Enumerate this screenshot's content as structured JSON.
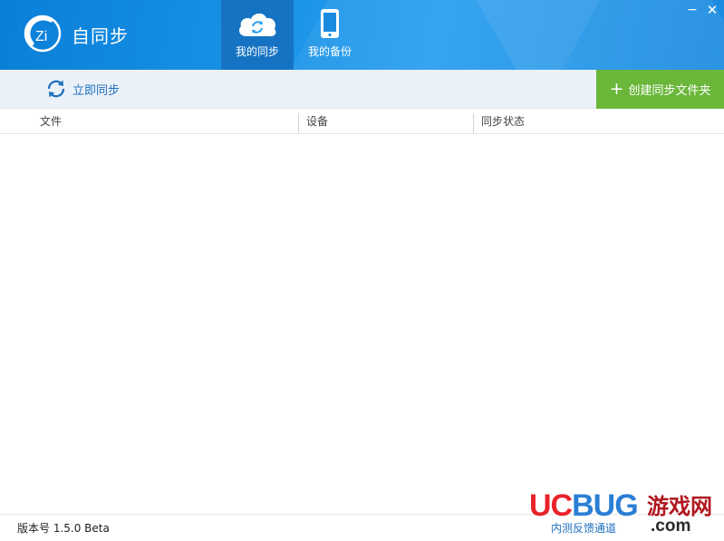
{
  "app": {
    "name": "自同步",
    "logo_text": "Zi"
  },
  "nav": {
    "tabs": [
      {
        "label": "我的同步",
        "icon": "cloud-sync-icon",
        "active": true
      },
      {
        "label": "我的备份",
        "icon": "phone-icon",
        "active": false
      }
    ]
  },
  "window": {
    "minimize": "−",
    "close": "✕"
  },
  "toolbar": {
    "sync_now_label": "立即同步",
    "create_folder_label": "创建同步文件夹",
    "create_plus": "+"
  },
  "table": {
    "columns": [
      "文件",
      "设备",
      "同步状态"
    ],
    "rows": []
  },
  "footer": {
    "version": "版本号 1.5.0 Beta",
    "feedback": "内测反馈通道"
  },
  "watermark": {
    "uc": "UC",
    "bug": "BUG",
    "cn": "游戏网",
    "com": ".com"
  },
  "colors": {
    "header_blue": "#1891e6",
    "active_tab": "#1673c4",
    "toolbar_bg": "#ebf1f8",
    "create_green": "#6ab73a",
    "link_blue": "#1f6fbe"
  }
}
